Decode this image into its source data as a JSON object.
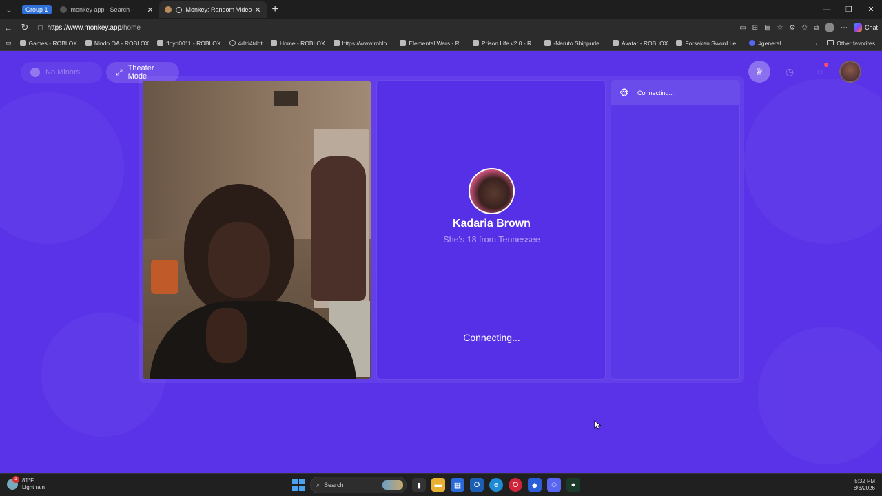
{
  "browser": {
    "group_label": "Group 1",
    "tabs": [
      {
        "title": "monkey app - Search"
      },
      {
        "title": "Monkey: Random Video Chat"
      }
    ],
    "url_domain": "https://www.monkey.app",
    "url_path": "/home",
    "chat_label": "Chat",
    "bookmarks": [
      "Games - ROBLOX",
      "Nindo OA - ROBLOX",
      "floyd0011 - ROBLOX",
      "4dtd4tddt",
      "Home - ROBLOX",
      "https://www.roblo...",
      "Elemental Wars - R...",
      "Prison Life v2.0 - R...",
      "-Naruto Shippude...",
      "Avatar - ROBLOX",
      "Forsaken Sword Le...",
      "#general"
    ],
    "other_favorites": "Other favorites"
  },
  "app": {
    "no_minors_label": "No Minors",
    "theater_mode_label": "Theater Mode",
    "match": {
      "name": "Kadaria Brown",
      "subtitle": "She's 18 from Tennessee",
      "status": "Connecting..."
    },
    "chat_status": "Connecting..."
  },
  "taskbar": {
    "temp": "81°F",
    "weather": "Light rain",
    "weather_badge": "1",
    "search_placeholder": "Search",
    "time": "5:32 PM",
    "date": "8/3/2026"
  },
  "colors": {
    "brand_purple": "#5a33e8",
    "browser_dark": "#202020"
  }
}
